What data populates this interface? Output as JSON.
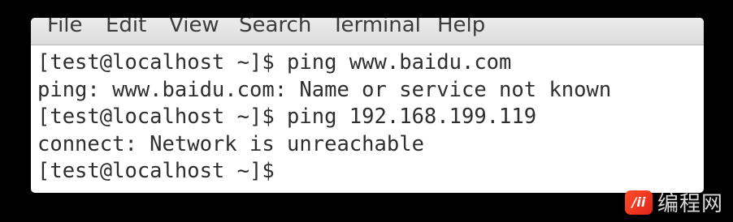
{
  "menu": {
    "items": [
      {
        "label": "File"
      },
      {
        "label": "Edit"
      },
      {
        "label": "View"
      },
      {
        "label": "Search"
      },
      {
        "label": "Terminal"
      },
      {
        "label": "Help"
      }
    ]
  },
  "terminal": {
    "lines": [
      "[test@localhost ~]$ ping www.baidu.com",
      "ping: www.baidu.com: Name or service not known",
      "[test@localhost ~]$ ping 192.168.199.119",
      "connect: Network is unreachable",
      "[test@localhost ~]$"
    ]
  },
  "watermark": {
    "mark": "/ii",
    "text": "编程网"
  }
}
